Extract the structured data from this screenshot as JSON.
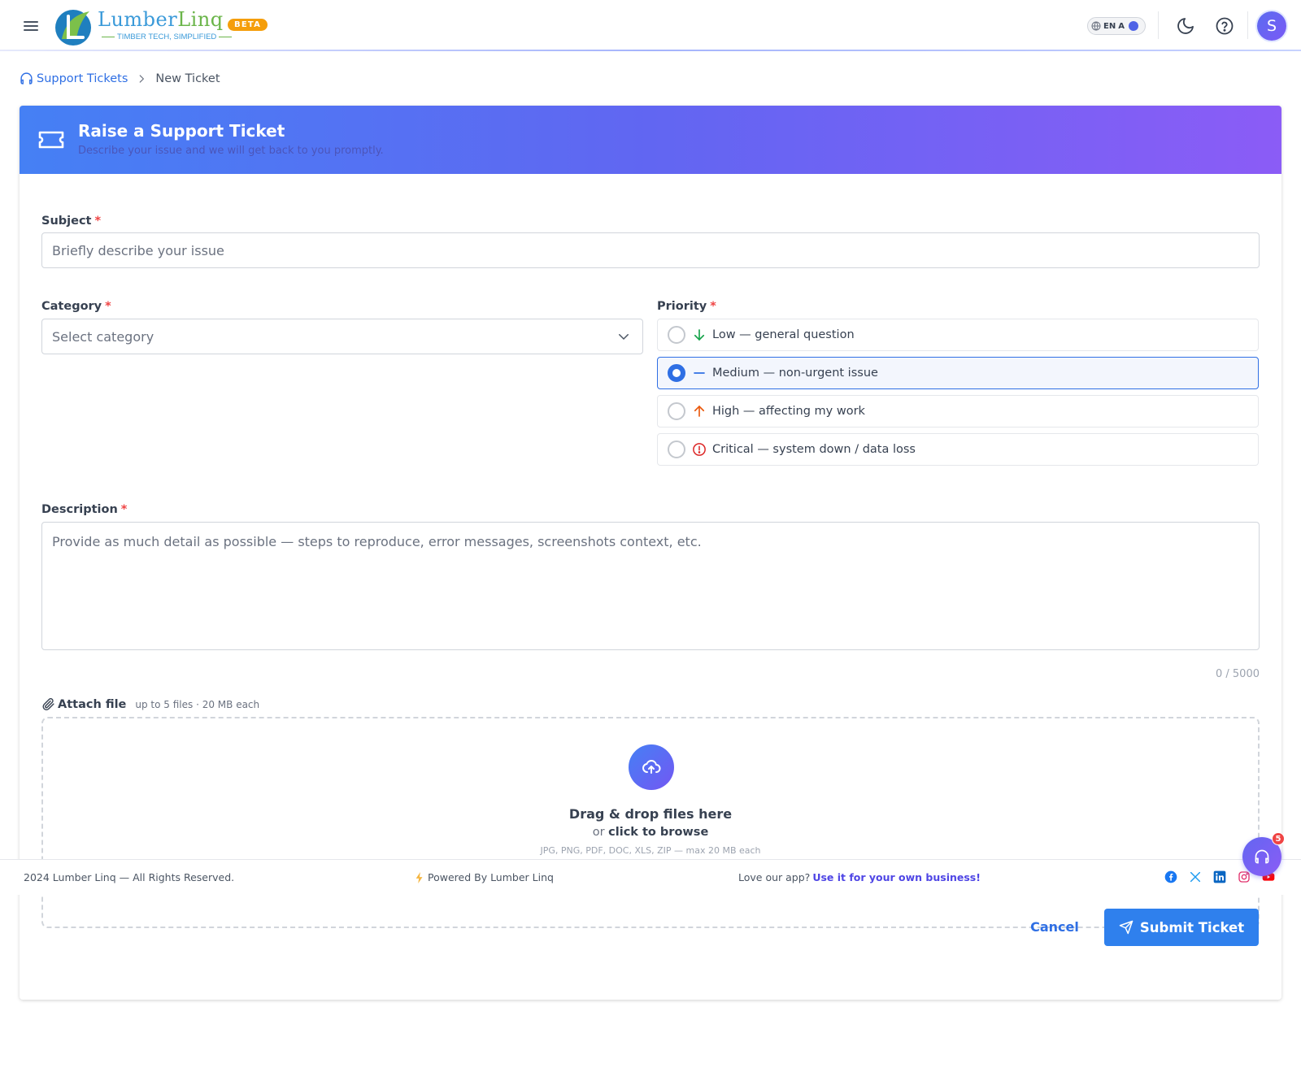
{
  "header": {
    "logo_part1": "Lumber",
    "logo_part2": "Linq",
    "logo_tagline": "TIMBER TECH, SIMPLIFIED",
    "beta_badge": "BETA",
    "lang_code": "EN",
    "lang_extra": "A",
    "avatar_initial": "S",
    "accent_color": "#4f63e6"
  },
  "breadcrumb": {
    "parent": "Support Tickets",
    "current": "New Ticket"
  },
  "card": {
    "title": "Raise a Support Ticket",
    "subtitle": "Describe your issue and we will get back to you promptly."
  },
  "form": {
    "subject": {
      "label": "Subject",
      "required_mark": "*",
      "placeholder": "Briefly describe your issue",
      "value": ""
    },
    "category": {
      "label": "Category",
      "required_mark": "*",
      "selected": "Select category"
    },
    "priority": {
      "label": "Priority",
      "required_mark": "*",
      "selected": "Medium",
      "options": [
        {
          "label": "Low — general question",
          "icon": "arrow-down-icon",
          "color": "#16a34a",
          "selected": false
        },
        {
          "label": "Medium — non-urgent issue",
          "icon": "dash-icon",
          "color": "#2f6fe4",
          "selected": true
        },
        {
          "label": "High — affecting my work",
          "icon": "arrow-up-icon",
          "color": "#ea580c",
          "selected": false
        },
        {
          "label": "Critical — system down / data loss",
          "icon": "alert-circle-icon",
          "color": "#dc2626",
          "selected": false
        }
      ]
    },
    "description": {
      "label": "Description",
      "required_mark": "*",
      "placeholder": "Provide as much detail as possible — steps to reproduce, error messages, screenshots context, etc.",
      "value": "",
      "counter": "0 / 5000"
    },
    "attach": {
      "title": "Attach file",
      "hint": "up to 5 files · 20 MB each",
      "drop_title": "Drag & drop files here",
      "drop_or": "or",
      "drop_browse": "click to browse",
      "drop_types": "JPG, PNG, PDF, DOC, XLS, ZIP — max 20 MB each"
    },
    "cancel_label": "Cancel",
    "submit_label": "Submit Ticket"
  },
  "footer": {
    "copyright": "2024 Lumber Linq — All Rights Reserved.",
    "powered": "Powered By Lumber Linq",
    "love_text": "Love our app?",
    "love_link": "Use it for your own business!",
    "socials": [
      "facebook-icon",
      "x-icon",
      "linkedin-icon",
      "instagram-icon",
      "youtube-icon"
    ]
  },
  "support_fab": {
    "badge_count": "5"
  }
}
